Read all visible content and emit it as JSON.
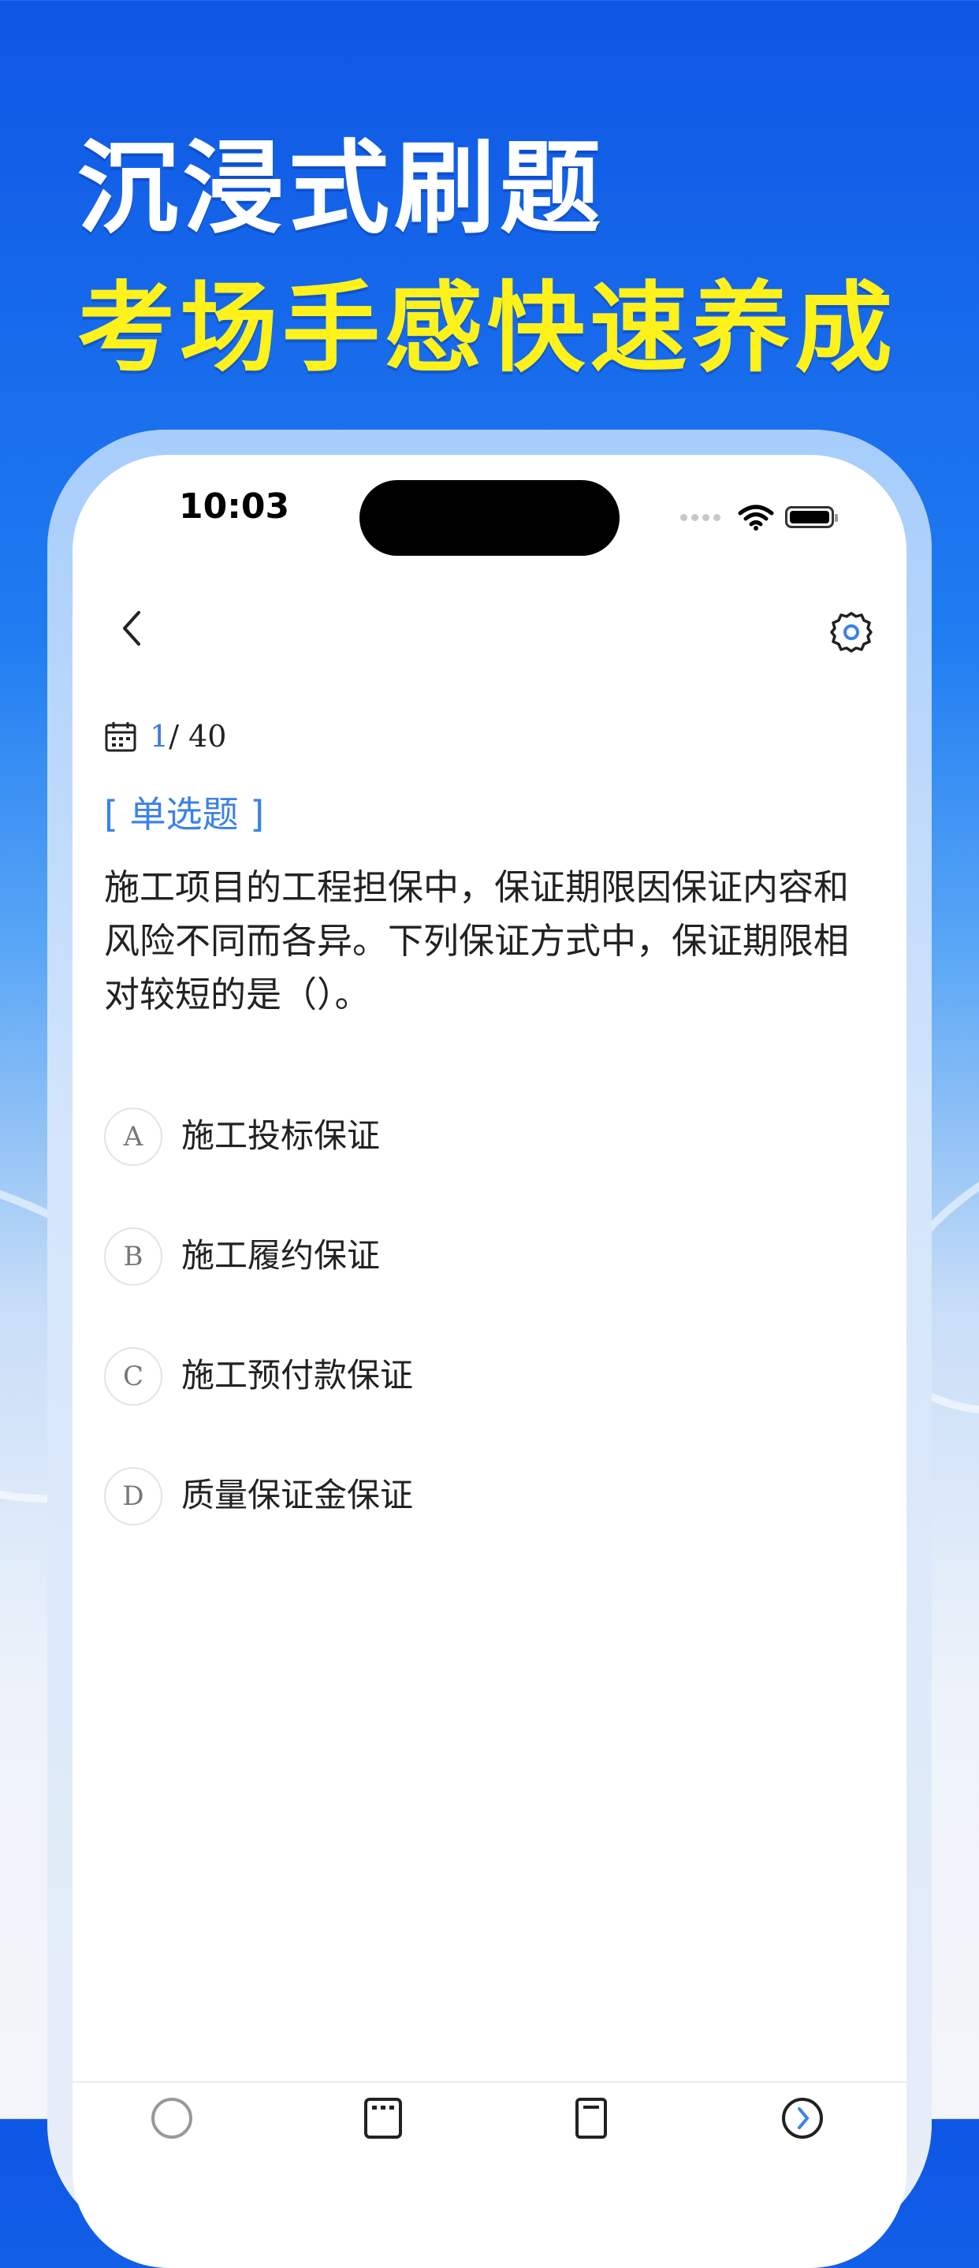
{
  "promo": {
    "line1": "沉浸式刷题",
    "line2": "考场手感快速养成"
  },
  "status_bar": {
    "time": "10:03"
  },
  "quiz": {
    "progress_current": "1",
    "progress_total": "/ 40",
    "question_type": "[ 单选题 ]",
    "question_text": "施工项目的工程担保中，保证期限因保证内容和风险不同而各异。下列保证方式中，保证期限相对较短的是（）。",
    "options": [
      {
        "letter": "A",
        "text": "施工投标保证"
      },
      {
        "letter": "B",
        "text": "施工履约保证"
      },
      {
        "letter": "C",
        "text": "施工预付款保证"
      },
      {
        "letter": "D",
        "text": "质量保证金保证"
      }
    ]
  },
  "colors": {
    "accent": "#3b82e8",
    "headline_yellow": "#fff21a"
  },
  "icons": {
    "back": "chevron-left-icon",
    "settings": "gear-icon",
    "calendar": "calendar-icon"
  }
}
